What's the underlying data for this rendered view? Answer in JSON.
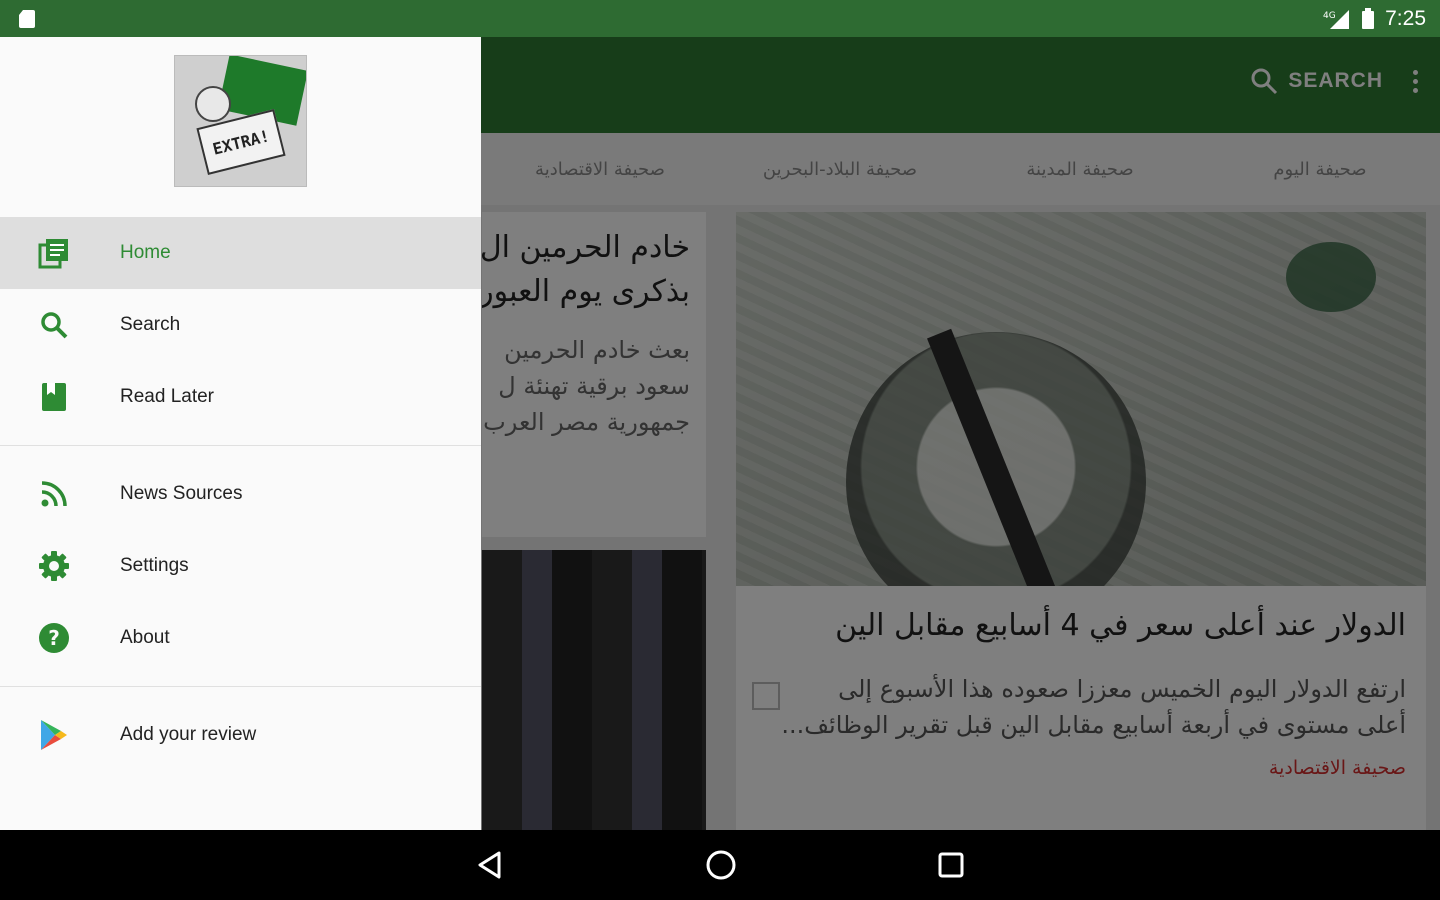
{
  "status_bar": {
    "time": "7:25",
    "network": "4G"
  },
  "app_bar": {
    "search_label": "SEARCH"
  },
  "tabs": [
    "صحيفة اليوم",
    "صحيفة المدينة",
    "صحيفة البلاد-البحرين",
    "صحيفة الاقتصادية"
  ],
  "articles": {
    "main": {
      "title": "الدولار عند أعلى سعر في 4 أسابيع مقابل الين",
      "description_line1": "ارتفع الدولار اليوم الخميس معززا صعوده هذا الأسبوع إلى",
      "description_line2": "أعلى مستوى في أربعة أسابيع مقابل الين قبل تقرير الوظائف...",
      "source": "صحيفة الاقتصادية"
    },
    "side": {
      "title_line1": "خادم الحرمين ال",
      "title_line2": "بذكرى يوم العبور",
      "desc_line1": "بعث خادم الحرمين",
      "desc_line2": "سعود برقية تهنئة ل",
      "desc_line3": "جمهورية مصر العرب"
    }
  },
  "drawer": {
    "logo_text": "EXTRA!",
    "items": [
      {
        "label": "Home",
        "icon": "home-icon"
      },
      {
        "label": "Search",
        "icon": "search-icon"
      },
      {
        "label": "Read Later",
        "icon": "bookmark-icon"
      },
      {
        "label": "News Sources",
        "icon": "rss-icon"
      },
      {
        "label": "Settings",
        "icon": "gear-icon"
      },
      {
        "label": "About",
        "icon": "help-icon"
      },
      {
        "label": "Add your review",
        "icon": "play-store-icon"
      }
    ]
  },
  "colors": {
    "primary": "#2f7a33",
    "status": "#2e6b32",
    "accent": "#2e8b34",
    "source_red": "#d32f2f"
  }
}
